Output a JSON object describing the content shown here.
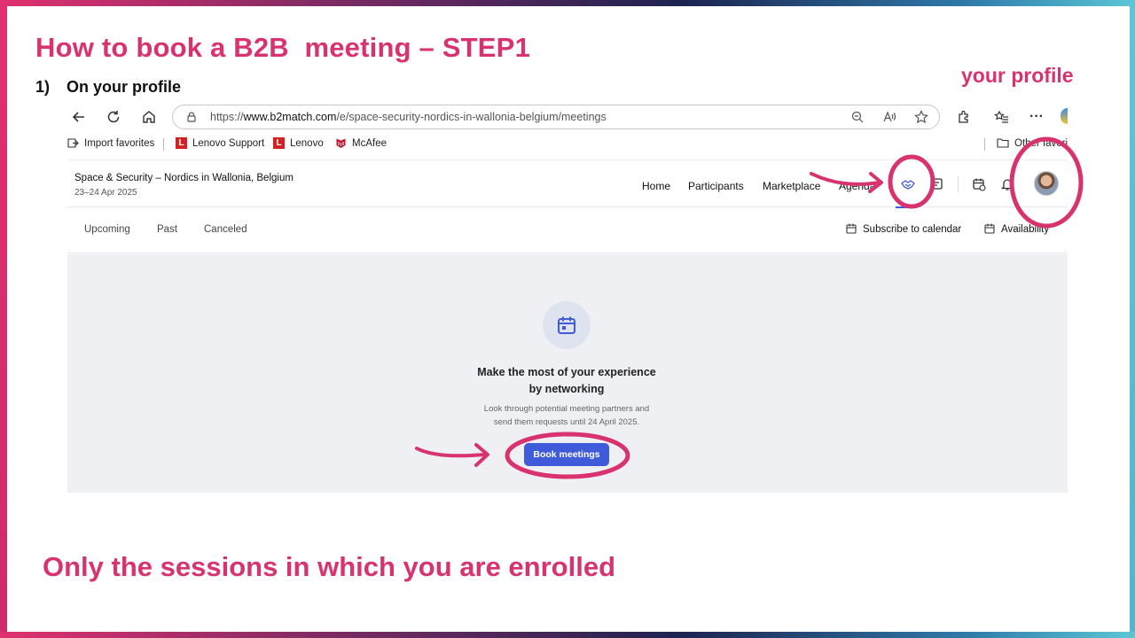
{
  "slide": {
    "title": "How to book a B2B  meeting – STEP1",
    "step_number": "1)",
    "step_text": "On your profile",
    "profile_callout": "your profile",
    "bottom_note": "Only the sessions in which you are enrolled",
    "accent_color": "#d9336f"
  },
  "browser": {
    "url_prefix": "https://",
    "url_domain": "www.b2match.com",
    "url_path": "/e/space-security-nordics-in-wallonia-belgium/meetings",
    "favorites": [
      {
        "label": "Import favorites",
        "icon": "import-icon"
      },
      {
        "label": "Lenovo Support",
        "icon": "lenovo-icon"
      },
      {
        "label": "Lenovo",
        "icon": "lenovo-icon"
      },
      {
        "label": "McAfee",
        "icon": "mcafee-icon"
      },
      {
        "label": "Other favorit",
        "icon": "folder-icon"
      }
    ]
  },
  "site": {
    "event_title": "Space & Security – Nordics in Wallonia, Belgium",
    "event_date": "23–24 Apr 2025",
    "nav": [
      "Home",
      "Participants",
      "Marketplace",
      "Agenda"
    ],
    "brand_color": "#3f5bd9"
  },
  "meetings": {
    "tabs": [
      "Upcoming",
      "Past",
      "Canceled"
    ],
    "subscribe_label": "Subscribe to calendar",
    "availability_label": "Availability",
    "empty_title_line1": "Make the most of your experience",
    "empty_title_line2": "by networking",
    "empty_sub_line1": "Look through potential meeting partners and",
    "empty_sub_line2": "send them requests until 24 April 2025.",
    "book_button": "Book meetings"
  }
}
